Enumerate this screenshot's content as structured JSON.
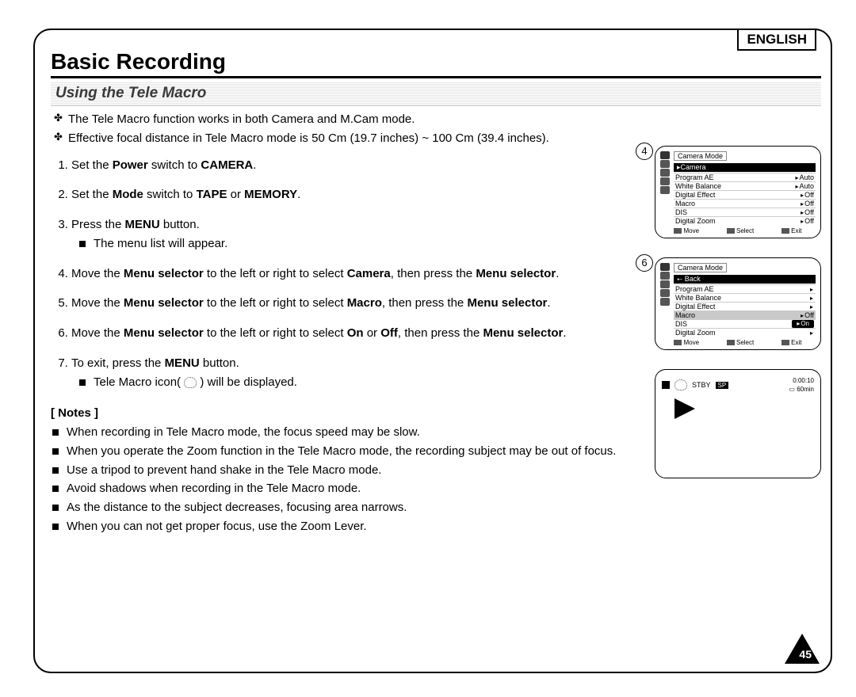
{
  "language_label": "ENGLISH",
  "heading": "Basic Recording",
  "subheading": "Using the Tele Macro",
  "intro": [
    "The Tele Macro function works in both Camera and M.Cam mode.",
    "Effective focal distance in Tele Macro mode is 50 Cm (19.7 inches) ~ 100 Cm (39.4 inches)."
  ],
  "steps": [
    {
      "pre": "Set the ",
      "b1": "Power",
      "mid": " switch to ",
      "b2": "CAMERA",
      "post": "."
    },
    {
      "pre": "Set the ",
      "b1": "Mode",
      "mid": " switch to ",
      "b2": "TAPE",
      "mid2": " or ",
      "b3": "MEMORY",
      "post": "."
    },
    {
      "pre": "Press the ",
      "b1": "MENU",
      "post": " button.",
      "sub": "The menu list will appear."
    },
    {
      "pre": "Move the ",
      "b1": "Menu selector",
      "mid": " to the left or right to select ",
      "b2": "Camera",
      "mid2": ", then press the ",
      "b3": "Menu selector",
      "post": "."
    },
    {
      "pre": "Move the ",
      "b1": "Menu selector",
      "mid": " to the left or right to select ",
      "b2": "Macro",
      "mid2": ", then press the ",
      "b3": "Menu selector",
      "post": "."
    },
    {
      "pre": "Move the ",
      "b1": "Menu selector",
      "mid": " to the left or right to select ",
      "b2": "On",
      "mid2": " or ",
      "b3": "Off",
      "mid3": ", then press the ",
      "b4": "Menu selector",
      "post": "."
    },
    {
      "pre": "To exit, press the ",
      "b1": "MENU",
      "post": " button.",
      "sub": "Tele Macro icon( ",
      "sub_post": " ) will be displayed."
    }
  ],
  "notes_label": "[ Notes ]",
  "notes": [
    "When recording in Tele Macro mode, the focus speed may be slow.",
    "When you operate the Zoom function in the Tele Macro mode, the recording subject may be out of focus.",
    "Use a tripod to prevent hand shake in the Tele Macro mode.",
    "Avoid shadows when recording in the Tele Macro mode.",
    "As the distance to the subject decreases, focusing area narrows.",
    "When you can not get proper focus, use the Zoom Lever."
  ],
  "fig4": {
    "callout": "4",
    "title": "Camera Mode",
    "highlight": "▸Camera",
    "rows": [
      {
        "l": "Program AE",
        "r": "Auto"
      },
      {
        "l": "White Balance",
        "r": "Auto"
      },
      {
        "l": "Digital Effect",
        "r": "Off"
      },
      {
        "l": "Macro",
        "r": "Off"
      },
      {
        "l": "DIS",
        "r": "Off"
      },
      {
        "l": "Digital Zoom",
        "r": "Off"
      }
    ],
    "foot": [
      "Move",
      "Select",
      "Exit"
    ]
  },
  "fig6": {
    "callout": "6",
    "title": "Camera Mode",
    "back": "⭠ Back",
    "rows": [
      "Program AE",
      "White Balance",
      "Digital Effect"
    ],
    "sel": {
      "l": "Macro",
      "r": "Off"
    },
    "after": [
      {
        "l": "DIS",
        "pill": "On"
      },
      {
        "l": "Digital Zoom"
      }
    ],
    "foot": [
      "Move",
      "Select",
      "Exit"
    ]
  },
  "status": {
    "stby": "STBY",
    "sp": "SP",
    "time": "0:00:10",
    "remain": "60min"
  },
  "page_number": "45"
}
